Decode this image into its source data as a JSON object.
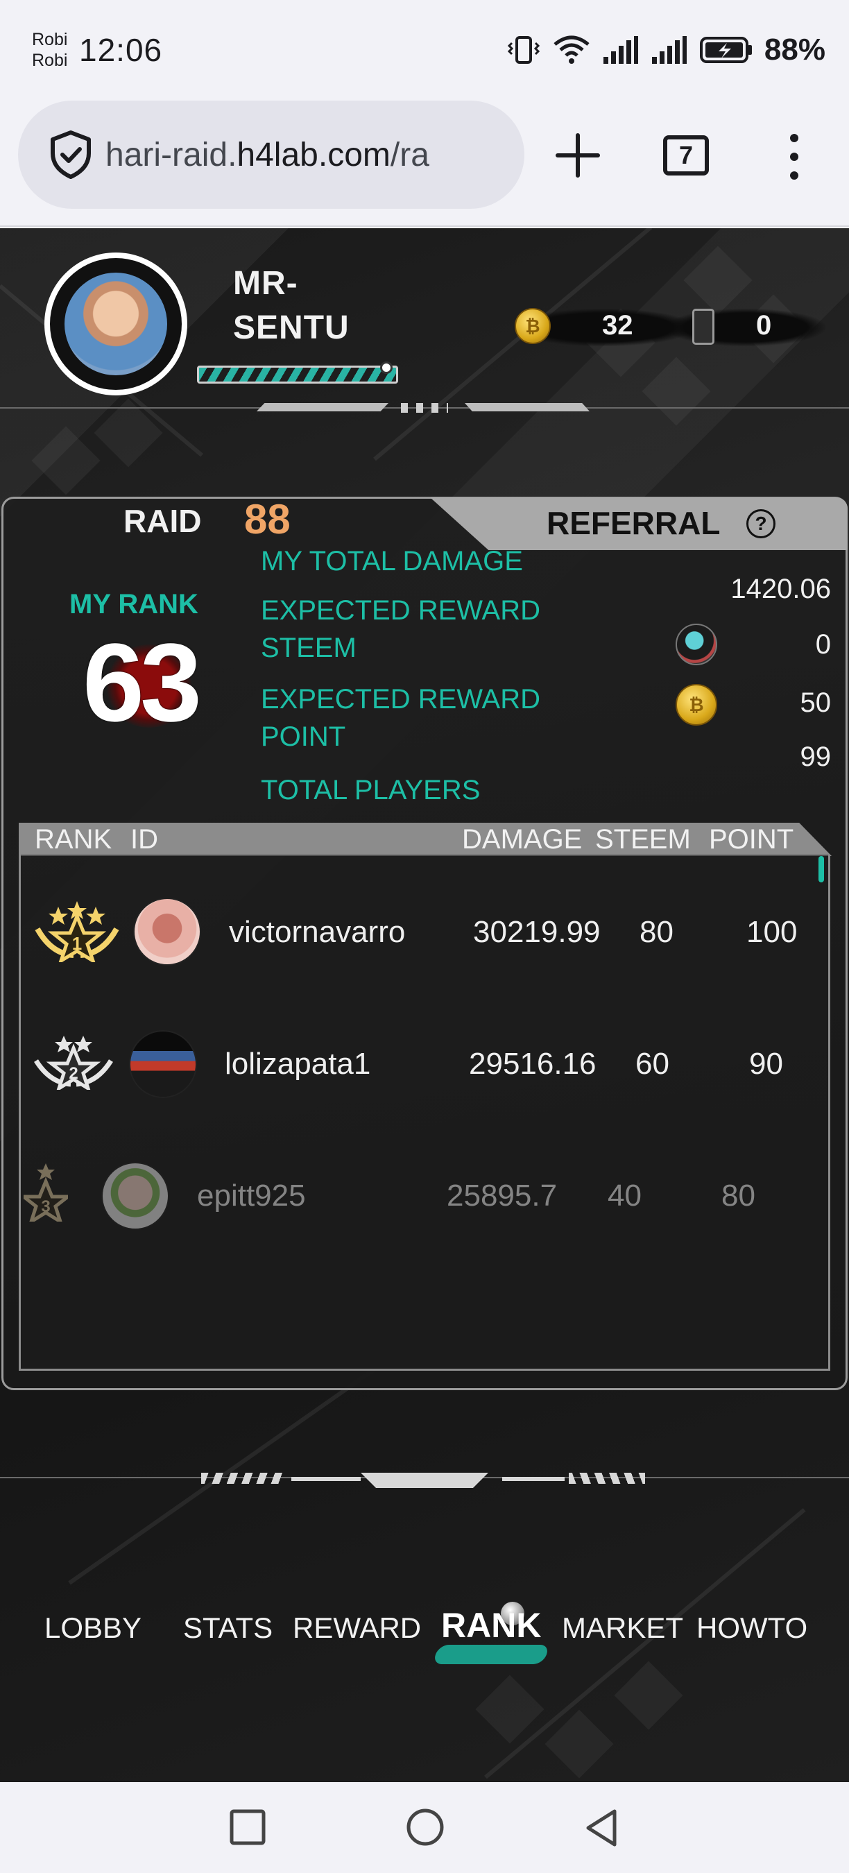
{
  "status_bar": {
    "carrier_1": "Robi",
    "carrier_2": "Robi",
    "time": "12:06",
    "battery_percent": "88%",
    "icons": [
      "vibrate-icon",
      "wifi-icon",
      "signal-icon",
      "signal-icon",
      "battery-charging-icon"
    ]
  },
  "browser": {
    "url_prefix": "hari-raid.",
    "url_host": "h4lab.com",
    "url_suffix": "/ra",
    "tab_count": "7",
    "icons": [
      "shield-icon",
      "plus-icon",
      "tabs-icon",
      "more-vert-icon"
    ]
  },
  "player": {
    "name_line1": "MR-",
    "name_line2": "SENTU",
    "coins": "32",
    "items": "0"
  },
  "tabs": {
    "raid_label": "RAID",
    "raid_number": "88",
    "referral_label": "REFERRAL",
    "help_label": "?"
  },
  "my_rank": {
    "label": "MY RANK",
    "value": "63"
  },
  "stats": {
    "total_damage_label": "MY TOTAL DAMAGE",
    "total_damage_value": "1420.06",
    "reward_steem_label_1": "EXPECTED REWARD",
    "reward_steem_label_2": "STEEM",
    "reward_steem_value": "0",
    "reward_point_label_1": "EXPECTED REWARD",
    "reward_point_label_2": "POINT",
    "reward_point_value": "50",
    "total_players_label": "TOTAL PLAYERS",
    "total_players_value": "99"
  },
  "table": {
    "headers": {
      "rank": "RANK",
      "id": "ID",
      "damage": "DAMAGE",
      "steem": "STEEM",
      "point": "POINT"
    },
    "rows": [
      {
        "rank": "1",
        "id": "victornavarro",
        "damage": "30219.99",
        "steem": "80",
        "point": "100"
      },
      {
        "rank": "2",
        "id": "lolizapata1",
        "damage": "29516.16",
        "steem": "60",
        "point": "90"
      },
      {
        "rank": "3",
        "id": "epitt925",
        "damage": "25895.7",
        "steem": "40",
        "point": "80"
      }
    ]
  },
  "nav": {
    "items": [
      "LOBBY",
      "STATS",
      "REWARD",
      "RANK",
      "MARKET",
      "HOWTO"
    ],
    "active": "RANK"
  },
  "colors": {
    "accent_teal": "#1dbfa6",
    "raid_orange": "#f0a566",
    "panel_border": "#9b9b9b"
  }
}
